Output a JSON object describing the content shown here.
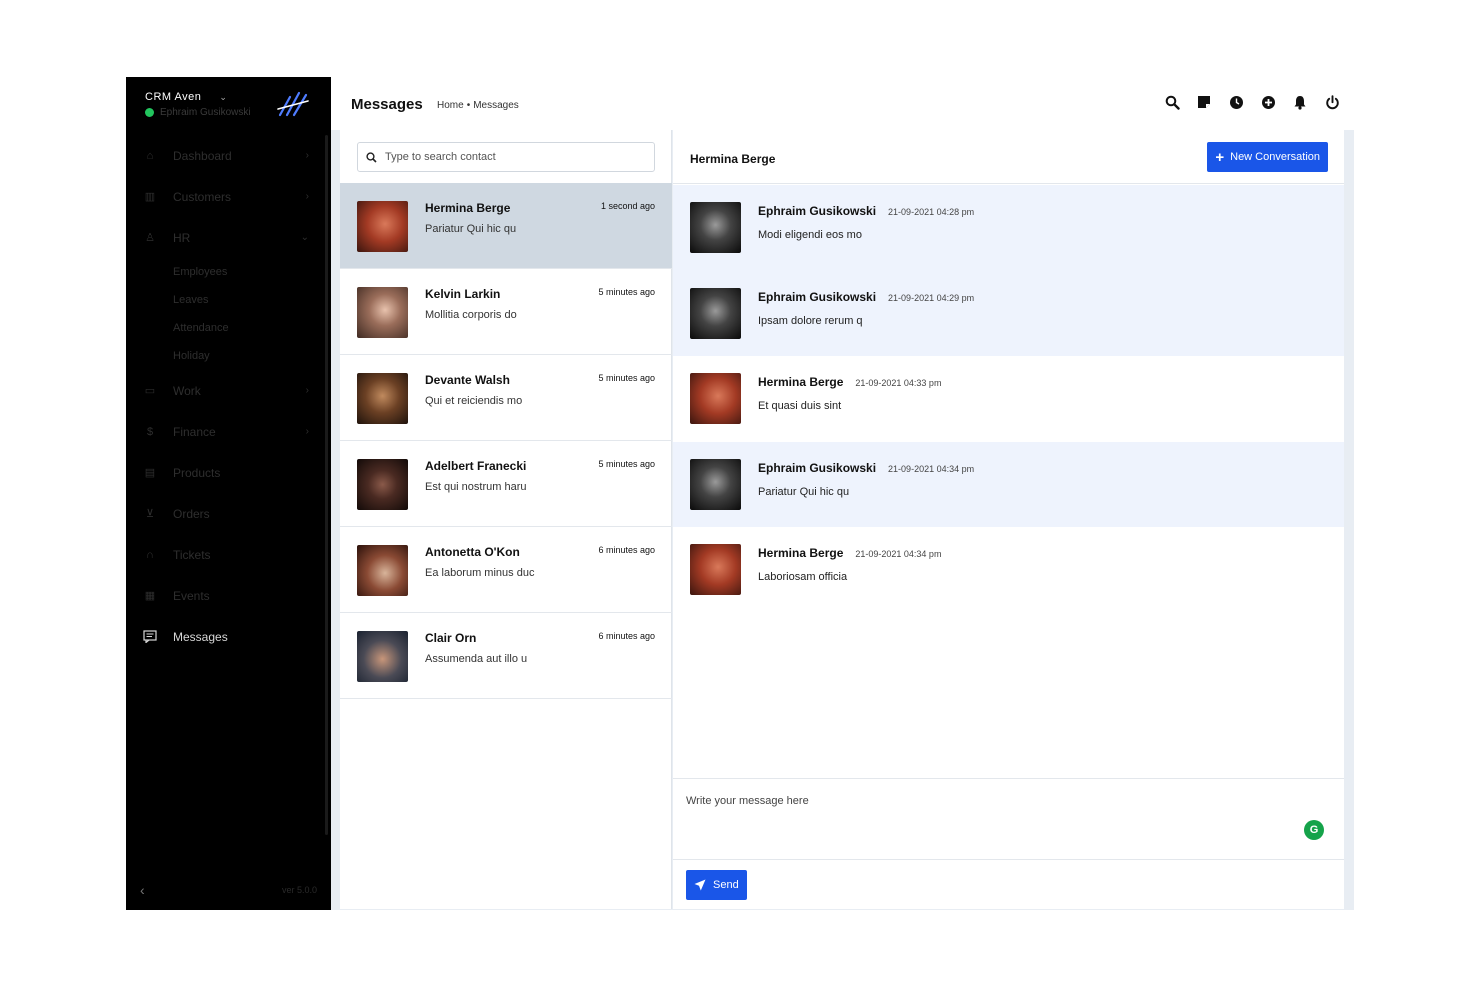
{
  "brand": {
    "name": "CRM Aven",
    "user": "Ephraim Gusikowski"
  },
  "header": {
    "title": "Messages",
    "breadcrumb": {
      "home": "Home",
      "sep": "•",
      "current": "Messages"
    }
  },
  "sidebar": {
    "items": [
      {
        "label": "Dashboard",
        "icon": "home-icon",
        "arrow": "›"
      },
      {
        "label": "Customers",
        "icon": "chart-icon",
        "arrow": "›"
      },
      {
        "label": "HR",
        "icon": "user-icon",
        "arrow": "⌄"
      },
      {
        "label": "Work",
        "icon": "briefcase-icon",
        "arrow": "›"
      },
      {
        "label": "Finance",
        "icon": "dollar-icon",
        "arrow": "›"
      },
      {
        "label": "Products",
        "icon": "box-icon",
        "arrow": ""
      },
      {
        "label": "Orders",
        "icon": "cart-icon",
        "arrow": ""
      },
      {
        "label": "Tickets",
        "icon": "headset-icon",
        "arrow": ""
      },
      {
        "label": "Events",
        "icon": "calendar-icon",
        "arrow": ""
      },
      {
        "label": "Messages",
        "icon": "message-icon",
        "arrow": ""
      }
    ],
    "hr_sub": [
      "Employees",
      "Leaves",
      "Attendance",
      "Holiday"
    ],
    "version": "ver 5.0.0"
  },
  "search": {
    "placeholder": "Type to search contact"
  },
  "contacts": [
    {
      "name": "Hermina Berge",
      "message": "Pariatur Qui hic qu",
      "time": "1 second ago",
      "color": "#b23a2a"
    },
    {
      "name": "Kelvin Larkin",
      "message": "Mollitia corporis do",
      "time": "5 minutes ago",
      "color": "#8a6a5a"
    },
    {
      "name": "Devante Walsh",
      "message": "Qui et reiciendis mo",
      "time": "5 minutes ago",
      "color": "#5a3a22"
    },
    {
      "name": "Adelbert Franecki",
      "message": "Est qui nostrum haru",
      "time": "5 minutes ago",
      "color": "#3a2a2a"
    },
    {
      "name": "Antonetta O'Kon",
      "message": "Ea laborum minus duc",
      "time": "6 minutes ago",
      "color": "#7a3a2a"
    },
    {
      "name": "Clair Orn",
      "message": "Assumenda aut illo u",
      "time": "6 minutes ago",
      "color": "#2a3a4a"
    }
  ],
  "chat": {
    "title": "Hermina Berge",
    "new_conversation": "New Conversation",
    "messages": [
      {
        "author": "Ephraim Gusikowski",
        "time": "21-09-2021 04:28 pm",
        "text": "Modi eligendi eos mo",
        "own": true
      },
      {
        "author": "Ephraim Gusikowski",
        "time": "21-09-2021 04:29 pm",
        "text": "Ipsam dolore rerum q",
        "own": true
      },
      {
        "author": "Hermina Berge",
        "time": "21-09-2021 04:33 pm",
        "text": "Et quasi duis sint",
        "own": false
      },
      {
        "author": "Ephraim Gusikowski",
        "time": "21-09-2021 04:34 pm",
        "text": "Pariatur Qui hic qu",
        "own": true
      },
      {
        "author": "Hermina Berge",
        "time": "21-09-2021 04:34 pm",
        "text": "Laboriosam officia",
        "own": false
      }
    ],
    "composer_placeholder": "Write your message here",
    "send_label": "Send"
  },
  "colors": {
    "accent": "#1a56e8",
    "sidebar_bg": "#000000",
    "selected_contact": "#cfd8e1",
    "own_message_bg": "#eef3fd",
    "online": "#22c55e"
  }
}
